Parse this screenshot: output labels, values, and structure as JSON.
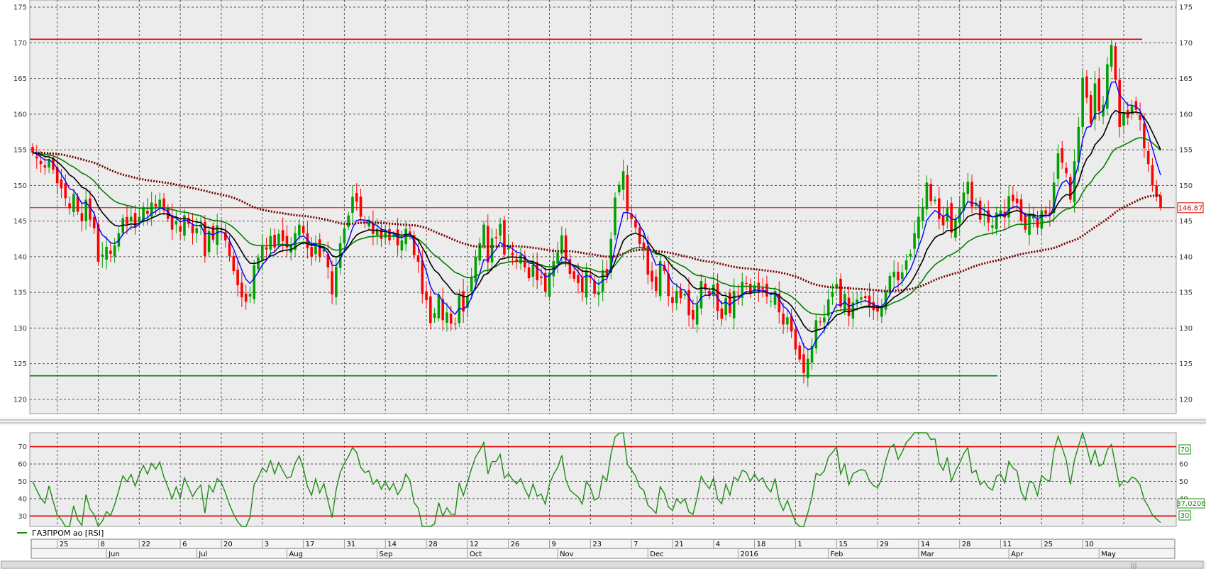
{
  "chart_data": [
    {
      "type": "candlestick",
      "panel": "price",
      "title": "",
      "ylim": [
        118,
        176
      ],
      "y_ticks": [
        120,
        125,
        130,
        135,
        140,
        145,
        150,
        155,
        160,
        165,
        170,
        175
      ],
      "grid": true,
      "last_price_label": "146.87",
      "horizontal_lines": [
        {
          "value": 170.5,
          "color": "#e00000"
        },
        {
          "value": 146.87,
          "color": "#e00000"
        },
        {
          "value": 123.3,
          "color": "#008000"
        }
      ],
      "series": [
        {
          "name": "close",
          "color_up": "#00a000",
          "color_down": "#ff0000",
          "values": [
            154.6,
            153.8,
            153.0,
            152.5,
            153.7,
            152.2,
            150.3,
            149.6,
            148.2,
            146.8,
            148.8,
            146.3,
            145.0,
            148.0,
            145.2,
            144.0,
            139.3,
            140.3,
            141.4,
            140.4,
            141.6,
            143.3,
            145.4,
            144.6,
            145.6,
            144.1,
            145.6,
            147.0,
            146.0,
            147.6,
            147.0,
            148.0,
            146.5,
            145.3,
            143.8,
            145.0,
            143.5,
            145.8,
            144.6,
            143.3,
            144.0,
            144.5,
            140.1,
            143.6,
            142.4,
            144.4,
            143.8,
            142.3,
            140.1,
            138.0,
            136.0,
            134.3,
            133.7,
            134.8,
            138.8,
            139.9,
            141.5,
            141.0,
            142.9,
            141.3,
            143.2,
            142.2,
            141.3,
            141.5,
            143.3,
            144.5,
            143.3,
            141.2,
            140.0,
            141.9,
            140.0,
            141.1,
            138.5,
            134.7,
            138.6,
            141.9,
            144.0,
            145.8,
            148.4,
            147.7,
            145.6,
            144.8,
            145.1,
            143.2,
            143.9,
            142.5,
            143.5,
            142.3,
            143.1,
            141.6,
            142.3,
            143.9,
            143.2,
            140.2,
            139.3,
            134.8,
            133.9,
            130.7,
            132.1,
            134.6,
            131.1,
            132.2,
            130.6,
            130.5,
            134.8,
            132.3,
            134.4,
            137.2,
            140.0,
            141.9,
            144.5,
            139.2,
            142.6,
            142.6,
            144.6,
            140.3,
            141.3,
            140.2,
            139.4,
            140.3,
            138.5,
            137.0,
            138.9,
            136.7,
            137.0,
            135.1,
            137.8,
            139.4,
            140.6,
            143.0,
            139.5,
            137.6,
            136.9,
            136.3,
            135.0,
            138.0,
            137.0,
            134.8,
            135.1,
            138.1,
            137.4,
            142.5,
            148.3,
            150.1,
            152.0,
            146.4,
            145.3,
            144.1,
            141.8,
            141.1,
            137.5,
            136.5,
            135.2,
            139.4,
            138.0,
            134.5,
            133.5,
            135.2,
            134.2,
            134.8,
            131.8,
            131.2,
            133.3,
            136.6,
            135.4,
            134.5,
            136.1,
            132.4,
            131.3,
            134.2,
            132.1,
            135.2,
            134.6,
            136.5,
            136.2,
            134.9,
            136.0,
            135.1,
            135.5,
            134.4,
            133.8,
            135.2,
            132.2,
            130.5,
            131.5,
            129.5,
            127.0,
            125.6,
            123.7,
            125.7,
            127.5,
            131.1,
            130.8,
            131.5,
            134.0,
            135.0,
            136.2,
            133.0,
            134.8,
            131.7,
            133.6,
            134.0,
            134.3,
            134.2,
            133.1,
            132.5,
            132.3,
            133.1,
            135.2,
            137.3,
            137.9,
            136.7,
            137.8,
            139.5,
            140.4,
            143.3,
            145.6,
            147.0,
            150.4,
            147.8,
            148.0,
            145.3,
            144.4,
            146.8,
            143.4,
            145.3,
            146.8,
            149.0,
            150.5,
            147.0,
            147.5,
            145.2,
            145.8,
            144.8,
            144.4,
            146.2,
            146.5,
            145.5,
            148.5,
            147.8,
            147.5,
            145.0,
            143.8,
            145.9,
            145.7,
            144.1,
            146.5,
            146.0,
            145.8,
            150.4,
            154.5,
            153.2,
            151.7,
            148.0,
            153.4,
            158.2,
            165.1,
            162.3,
            158.7,
            164.3,
            160.4,
            161.3,
            167.0,
            169.7,
            164.8,
            158.2,
            160.2,
            159.5,
            161.1,
            160.6,
            159.2,
            155.2,
            153.0,
            150.0,
            148.4,
            146.9
          ]
        },
        {
          "name": "EMA fast",
          "color": "#0000ff"
        },
        {
          "name": "EMA medium",
          "color": "#000000"
        },
        {
          "name": "EMA slow",
          "color": "#008000"
        },
        {
          "name": "EMA long",
          "color": "#7a0000"
        }
      ]
    },
    {
      "type": "line",
      "panel": "rsi",
      "title": "",
      "ylim": [
        24,
        78
      ],
      "y_ticks": [
        30,
        40,
        50,
        60,
        70
      ],
      "levels": [
        30,
        70
      ],
      "level_labels": [
        "70",
        "30"
      ],
      "last_value_label": "37.0206",
      "legend_label": "ГАЗПРОМ ао [RSI]",
      "color": "#1e8c14"
    },
    {
      "type": "time_axis",
      "day_labels": [
        "25",
        "8",
        "22",
        "6",
        "20",
        "3",
        "17",
        "31",
        "14",
        "28",
        "12",
        "26",
        "9",
        "23",
        "7",
        "21",
        "4",
        "18",
        "1",
        "15",
        "29",
        "14",
        "28",
        "11",
        "25",
        "10"
      ],
      "month_labels": [
        "Jun",
        "Jul",
        "Aug",
        "Sep",
        "Oct",
        "Nov",
        "Dec",
        "2016",
        "Feb",
        "Mar",
        "Apr",
        "May"
      ]
    }
  ]
}
